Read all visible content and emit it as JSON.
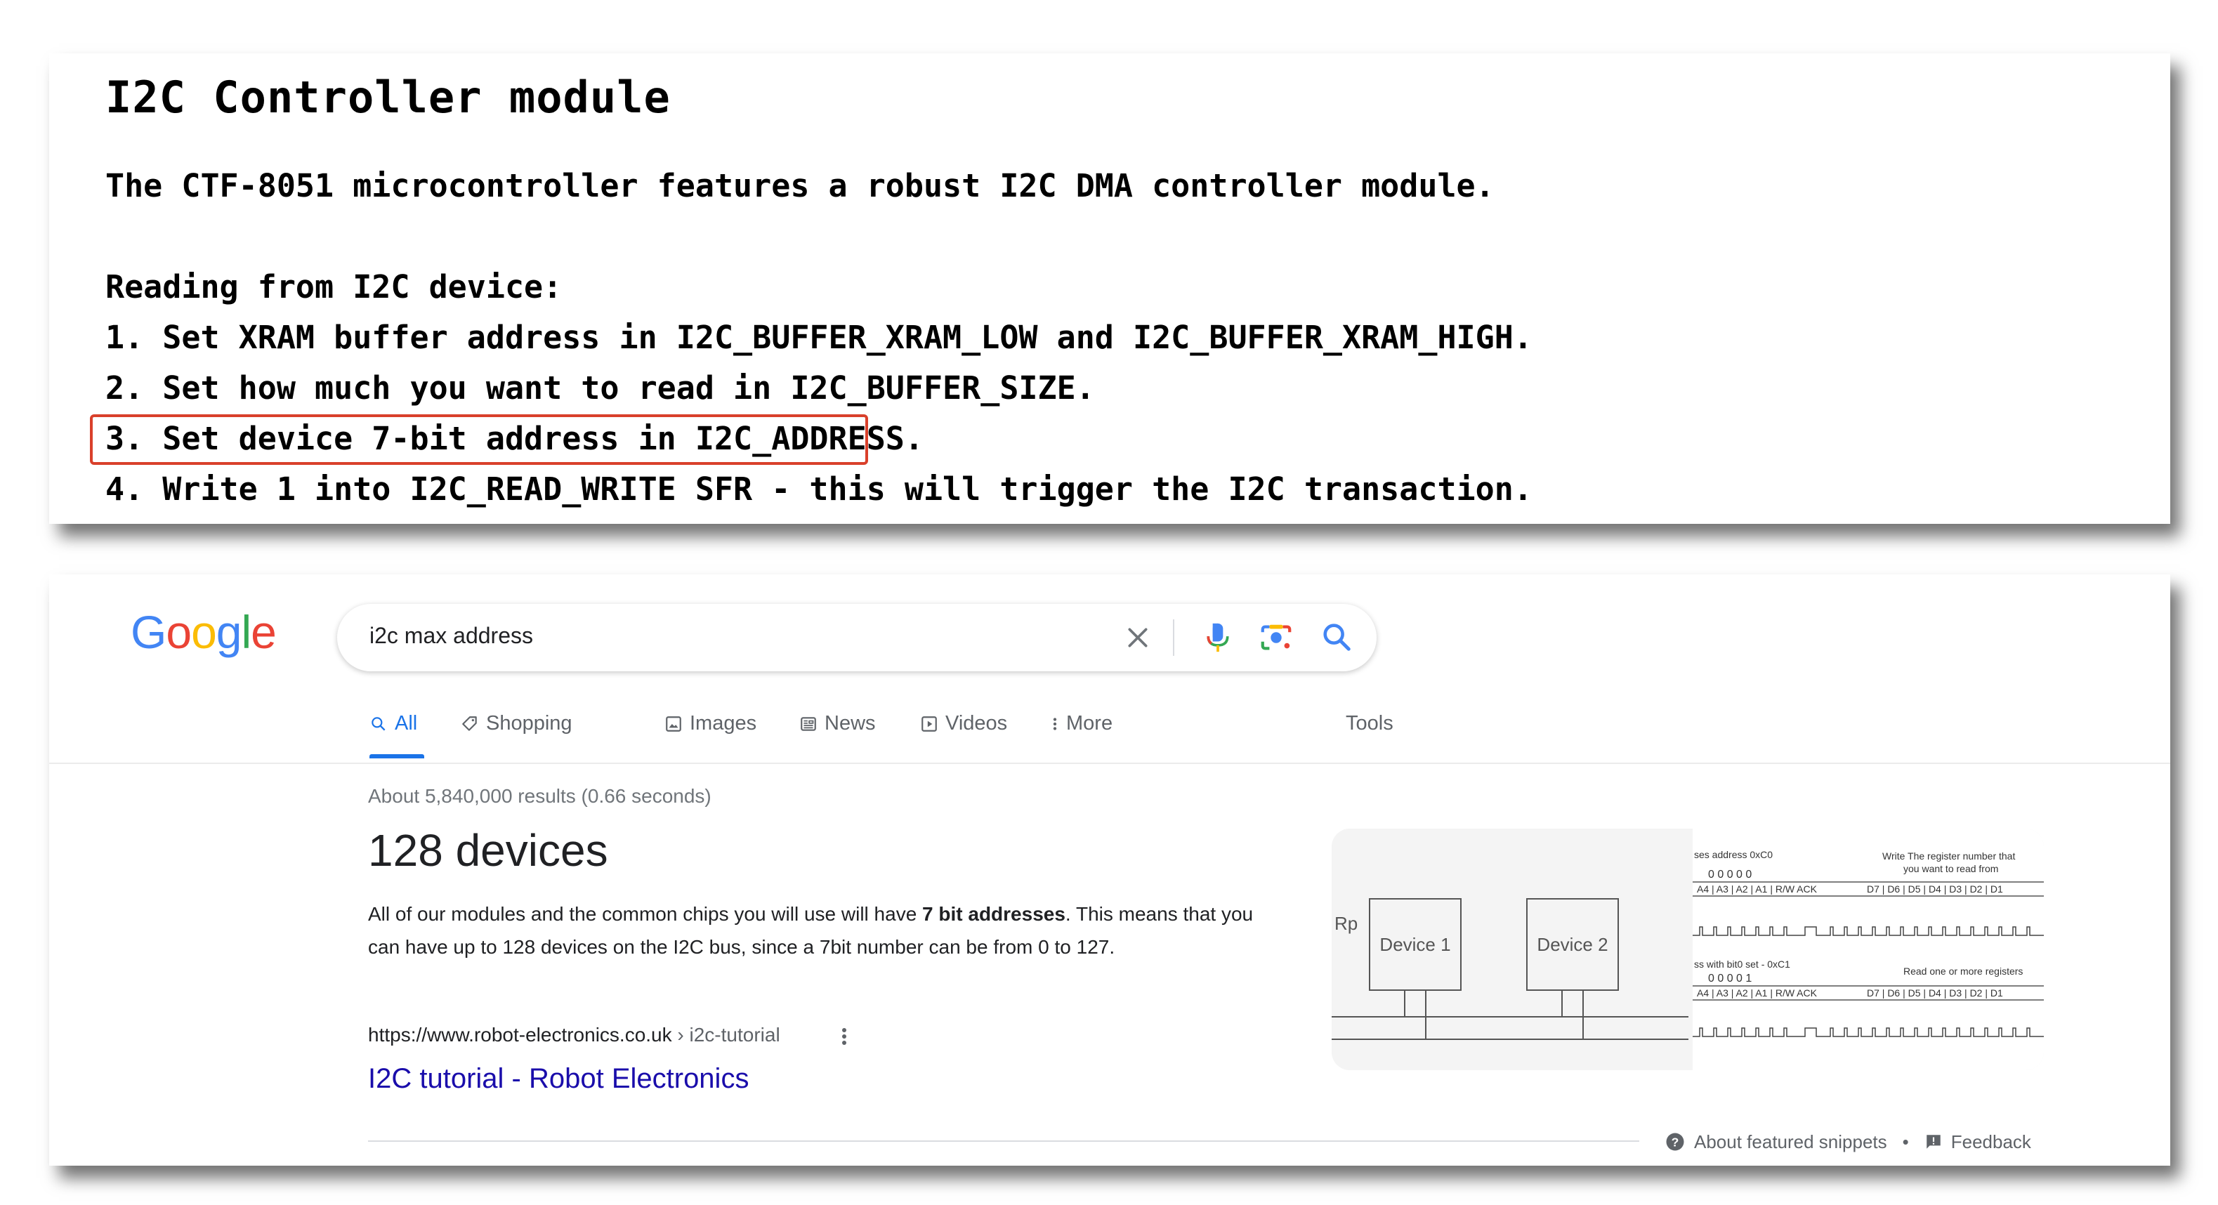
{
  "doc": {
    "title": "I2C Controller module",
    "intro": "The CTF-8051 microcontroller features a robust I2C DMA controller module.",
    "heading": "Reading from I2C device:",
    "steps": [
      "1. Set XRAM buffer address in I2C_BUFFER_XRAM_LOW and I2C_BUFFER_XRAM_HIGH.",
      "2. Set how much you want to read in I2C_BUFFER_SIZE.",
      "3. Set device 7-bit address in I2C_ADDRESS.",
      "4. Write 1 into I2C_READ_WRITE SFR - this will trigger the I2C transaction."
    ],
    "highlight_color": "#d9402b"
  },
  "google": {
    "logo_letters": [
      "G",
      "o",
      "o",
      "g",
      "l",
      "e"
    ],
    "logo_colors": [
      "#4285f4",
      "#ea4335",
      "#fbbc05",
      "#4285f4",
      "#34a853",
      "#ea4335"
    ],
    "search": {
      "query": "i2c max address",
      "icons": [
        "close-icon",
        "microphone-icon",
        "camera-lens-icon",
        "search-icon"
      ]
    },
    "tabs": [
      {
        "label": "All",
        "icon": "search-icon",
        "active": true
      },
      {
        "label": "Shopping",
        "icon": "tag-icon"
      },
      {
        "label": "Images",
        "icon": "image-icon"
      },
      {
        "label": "News",
        "icon": "newspaper-icon"
      },
      {
        "label": "Videos",
        "icon": "play-icon"
      },
      {
        "label": "More",
        "icon": "kebab-icon"
      }
    ],
    "tools_label": "Tools",
    "result_stats": "About 5,840,000 results (0.66 seconds)",
    "answer": {
      "title": "128 devices",
      "snippet_before": "All of our modules and the common chips you will use will have ",
      "snippet_bold": "7 bit addresses",
      "snippet_after": ". This means that you can have up to 128 devices on the I2C bus, since a 7bit number can be from 0 to 127."
    },
    "source": {
      "url": "https://www.robot-electronics.co.uk",
      "path": " › i2c-tutorial",
      "title": "I2C tutorial - Robot Electronics"
    },
    "footer": {
      "about": "About featured snippets",
      "separator": "•",
      "feedback": "Feedback"
    },
    "diagram": {
      "rp_label": "Rp",
      "device1": "Device 1",
      "device2": "Device 2",
      "timing_top_left": "ses address 0xC0",
      "timing_top_right_1": "Write The register number that",
      "timing_top_right_2": "you want to read from",
      "timing_mid_left": "ss with bit0 set - 0xC1",
      "timing_mid_right": "Read one or more registers",
      "bits_row": "0   0   0   0   0",
      "bits_row2": "0   0   0   0   1",
      "addr_cells": "A4 | A3 | A2 | A1 | R/W  ACK",
      "data_cells": "D7 | D6 | D5 | D4 | D3 | D2 | D1"
    }
  }
}
